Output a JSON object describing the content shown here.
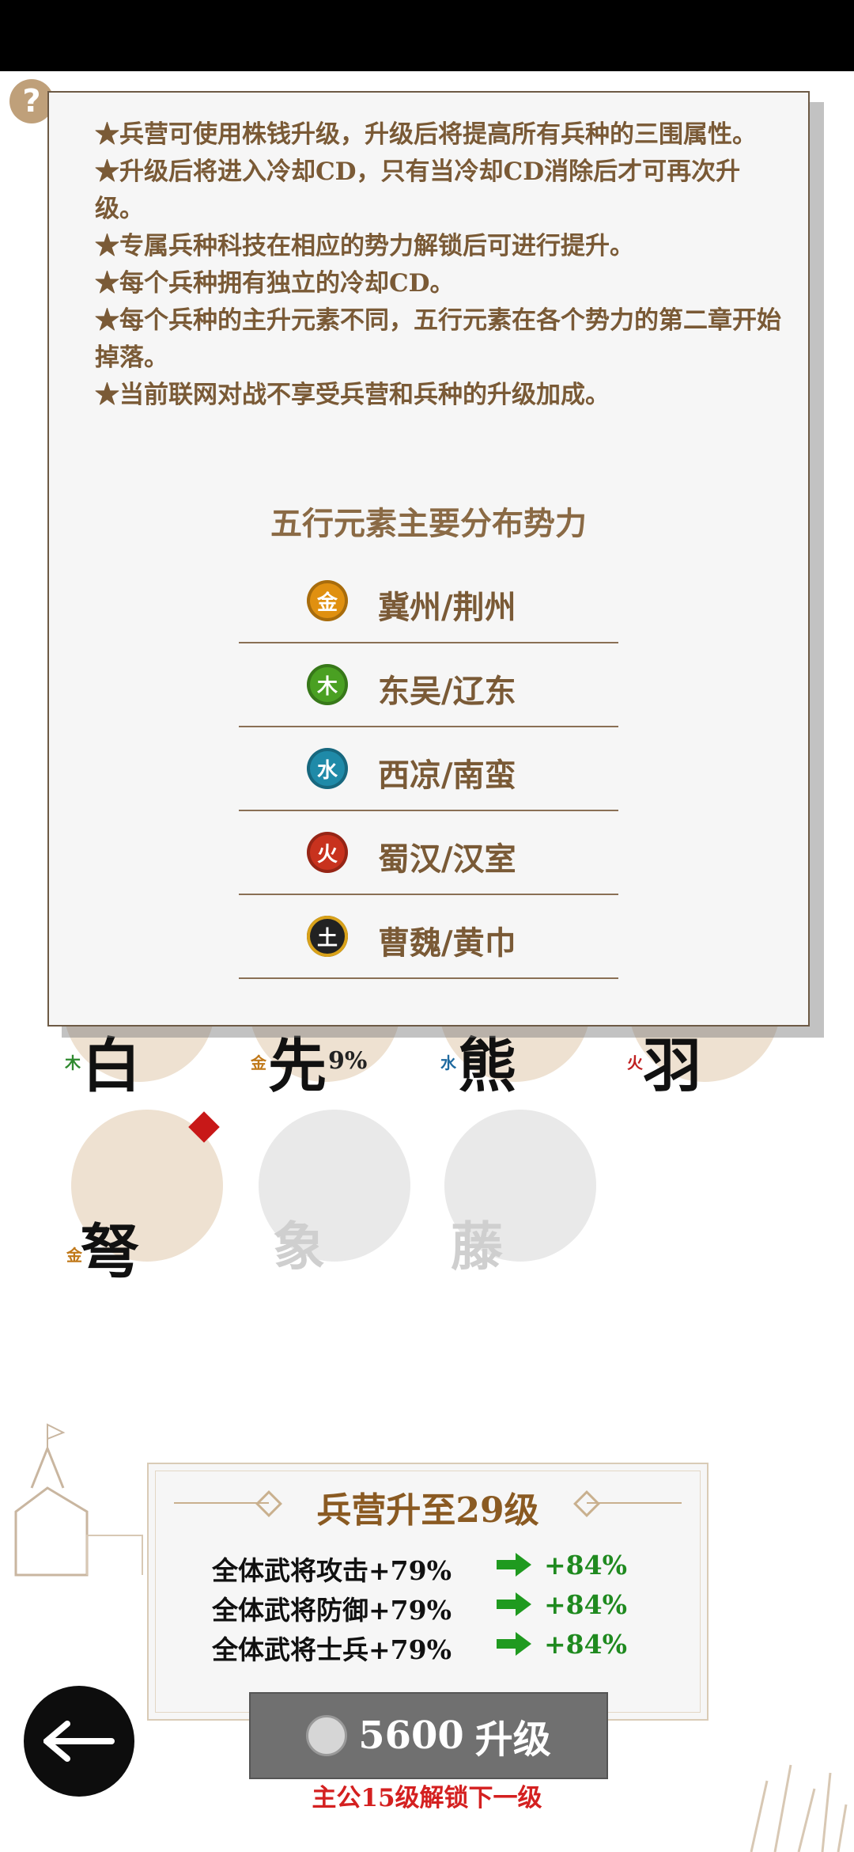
{
  "help_button": "?",
  "popup": {
    "rules": [
      "★兵营可使用株钱升级，升级后将提高所有兵种的三围属性。",
      "★升级后将进入冷却CD，只有当冷却CD消除后才可再次升级。",
      "★专属兵种科技在相应的势力解锁后可进行提升。",
      "★每个兵种拥有独立的冷却CD。",
      "★每个兵种的主升元素不同，五行元素在各个势力的第二章开始掉落。",
      "★当前联网对战不享受兵营和兵种的升级加成。"
    ],
    "distribution_title": "五行元素主要分布势力",
    "distribution": [
      {
        "icon": "metal-element-icon",
        "glyph": "金",
        "color": "#e09010",
        "label": "冀州/荆州"
      },
      {
        "icon": "wood-element-icon",
        "glyph": "木",
        "color": "#4aa022",
        "label": "东吴/辽东"
      },
      {
        "icon": "water-element-icon",
        "glyph": "水",
        "color": "#1f8aa8",
        "label": "西凉/南蛮"
      },
      {
        "icon": "fire-element-icon",
        "glyph": "火",
        "color": "#c8321e",
        "label": "蜀汉/汉室"
      },
      {
        "icon": "earth-element-icon",
        "glyph": "土",
        "color": "#222222",
        "label": "曹魏/黄巾"
      }
    ]
  },
  "units": [
    {
      "name": "白",
      "element": "木",
      "element_color": "#2f8a2f",
      "percent": ""
    },
    {
      "name": "先",
      "element": "金",
      "element_color": "#c07818",
      "percent": "9%"
    },
    {
      "name": "熊",
      "element": "水",
      "element_color": "#1f6aa0",
      "percent": ""
    },
    {
      "name": "羽",
      "element": "火",
      "element_color": "#c02020",
      "percent": ""
    },
    {
      "name": "弩",
      "element": "金",
      "element_color": "#c07818",
      "percent": ""
    },
    {
      "name": "象",
      "element": "",
      "element_color": "",
      "percent": ""
    },
    {
      "name": "藤",
      "element": "",
      "element_color": "",
      "percent": ""
    }
  ],
  "upgrade": {
    "title": "兵营升至29级",
    "stats": [
      {
        "current": "全体武将攻击+79%",
        "next": "+84%"
      },
      {
        "current": "全体武将防御+79%",
        "next": "+84%"
      },
      {
        "current": "全体武将士兵+79%",
        "next": "+84%"
      }
    ],
    "button_cost": "5600",
    "button_label": "升级",
    "unlock_hint": "主公15级解锁下一级"
  },
  "colors": {
    "accent": "#8a5a22",
    "positive": "#1f8a1f",
    "warning": "#d42020"
  }
}
